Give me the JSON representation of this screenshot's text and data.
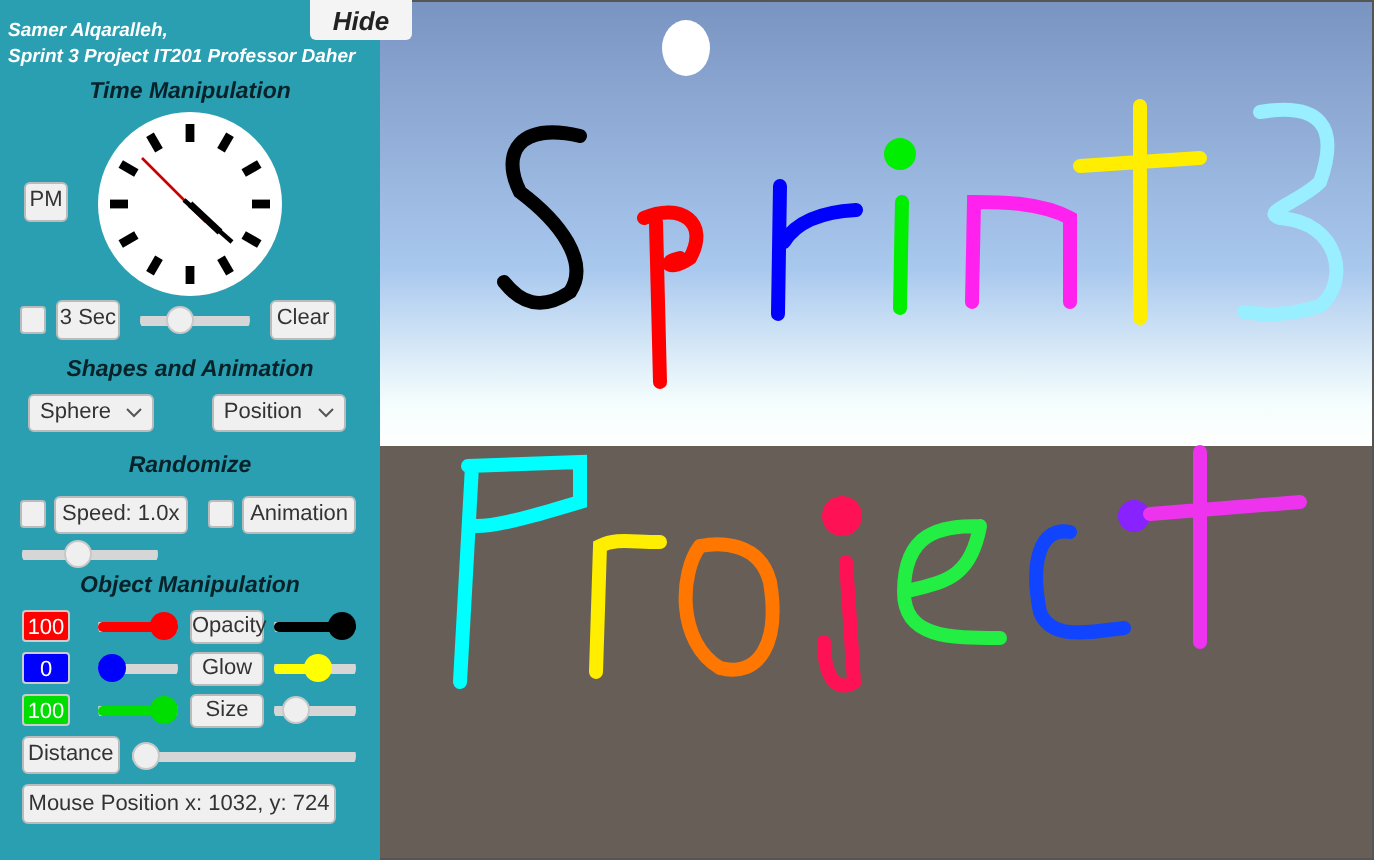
{
  "header": {
    "line_1": "Samer Alqaralleh,",
    "line_2": "Sprint 3 Project IT201 Professor Daher"
  },
  "hide_button": "Hide",
  "time": {
    "title": "Time Manipulation",
    "ampm_button": "PM",
    "checked": false,
    "duration_button": "3 Sec",
    "level": 0.32,
    "clear_button": "Clear"
  },
  "shapes": {
    "title": "Shapes and Animation",
    "dropdowns": [
      "Sphere",
      "Position"
    ]
  },
  "randomize": {
    "title": "Randomize",
    "options": [
      {
        "label": "Speed: 1.0x",
        "checked": false
      },
      {
        "label": "Animation",
        "checked": false
      }
    ],
    "level": 0.38
  },
  "object": {
    "title": "Object Manipulation",
    "channels": [
      {
        "value": "100",
        "color": "#ff0000",
        "level": 1
      },
      {
        "value": "0",
        "color": "#0000ff",
        "level": 0
      },
      {
        "value": "100",
        "color": "#00dd00",
        "level": 1
      }
    ],
    "properties": [
      {
        "label": "Opacity",
        "color": "#000000",
        "level": 1
      },
      {
        "label": "Glow",
        "color": "#ffff00",
        "level": 0.55
      },
      {
        "label": "Size",
        "level": 0.15
      }
    ],
    "distance": {
      "label": "Distance",
      "level": 0
    }
  },
  "mouse_position": "Mouse Position x: 1032, y: 724"
}
